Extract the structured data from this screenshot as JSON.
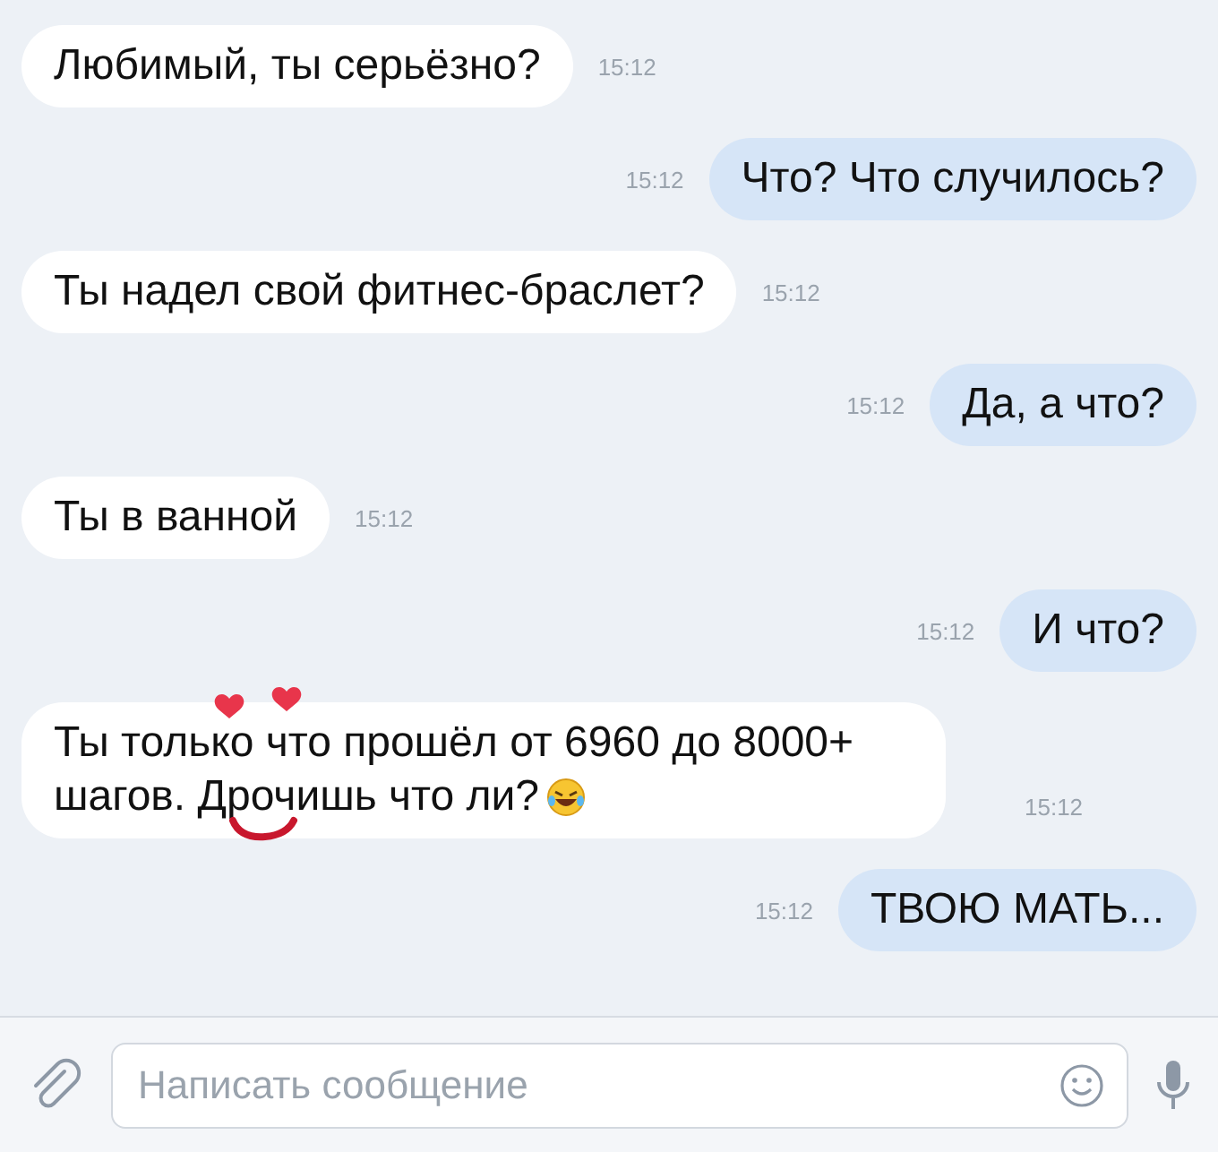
{
  "messages": [
    {
      "kind": "incoming",
      "text": "Любимый, ты серьёзно?",
      "time": "15:12"
    },
    {
      "kind": "outgoing",
      "text": "Что? Что случилось?",
      "time": "15:12"
    },
    {
      "kind": "incoming",
      "text": "Ты надел свой фитнес-браслет?",
      "time": "15:12"
    },
    {
      "kind": "outgoing",
      "text": "Да, а что?",
      "time": "15:12"
    },
    {
      "kind": "incoming",
      "text": "Ты в ванной",
      "time": "15:12"
    },
    {
      "kind": "outgoing",
      "text": "И что?",
      "time": "15:12"
    },
    {
      "kind": "incoming",
      "text": "Ты только что прошёл от 6960 до 8000+ шагов. Дрочишь что ли?",
      "time": "15:12",
      "emoji": true,
      "doodle": true
    },
    {
      "kind": "outgoing",
      "text": "ТВОЮ МАТЬ...",
      "time": "15:12"
    }
  ],
  "composer": {
    "placeholder": "Написать сообщение"
  }
}
